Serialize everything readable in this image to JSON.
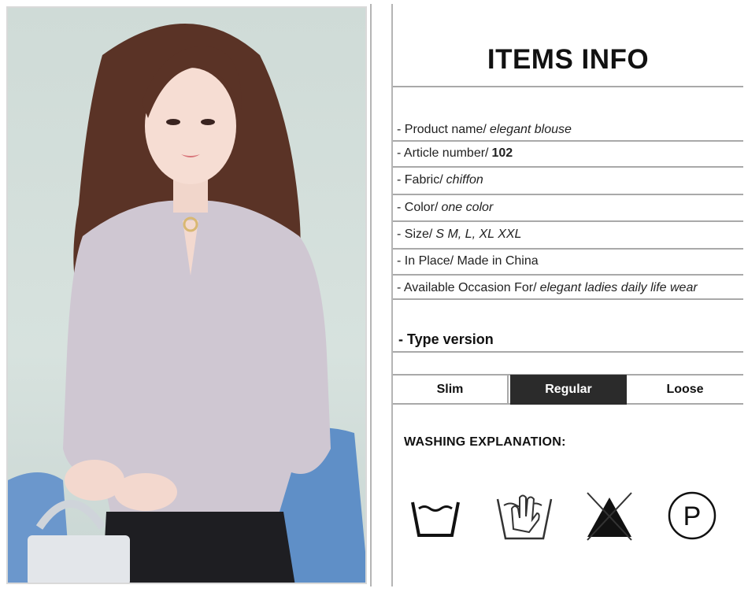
{
  "header": {
    "title": "ITEMS INFO"
  },
  "specs": [
    {
      "label": "- Product name/",
      "value": "elegant blouse",
      "bold": false
    },
    {
      "label": "- Article number/",
      "value": "102",
      "bold": true
    },
    {
      "label": "- Fabric/",
      "value": "chiffon",
      "bold": false
    },
    {
      "label": "- Color/",
      "value": "one color",
      "bold": false
    },
    {
      "label": "- Size/",
      "value": "S M, L, XL XXL",
      "bold": false
    },
    {
      "label": "- In Place/ Made in China",
      "value": "",
      "bold": false
    },
    {
      "label": "- Available Occasion For/",
      "value": "elegant ladies daily life wear",
      "bold": false
    }
  ],
  "type_version": {
    "title": "- Type version",
    "options": [
      "Slim",
      "Regular",
      "Loose"
    ],
    "selected": "Regular"
  },
  "washing": {
    "title": "WASHING EXPLANATION:",
    "icons": [
      "machine-wash-icon",
      "hand-wash-icon",
      "do-not-bleach-icon",
      "dry-clean-p-icon"
    ],
    "dry_clean_letter": "P"
  },
  "colors": {
    "border": "#a9a9a9",
    "selected_bg": "#2b2b2b",
    "selected_text": "#ffffff"
  }
}
